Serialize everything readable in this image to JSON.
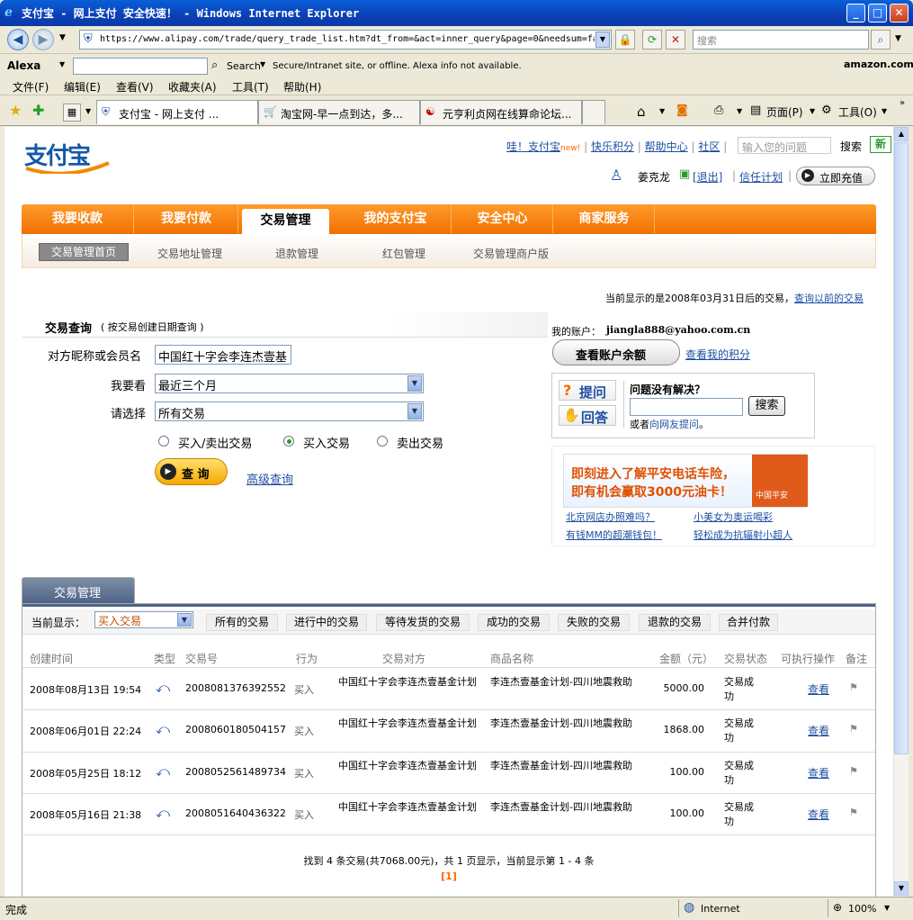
{
  "window": {
    "title": "支付宝 - 网上支付 安全快速！ - Windows Internet Explorer",
    "url": "https://www.alipay.com/trade/query_trade_list.htm?dt_from=&act=inner_query&page=0&needsum=fa",
    "search_placeholder": "搜索",
    "zoom": "100%",
    "status_left": "完成",
    "status_zone": "Internet"
  },
  "alexa": {
    "logo": "Alexa",
    "search_label": "Search",
    "info": "Secure/Intranet site, or offline. Alexa info not available.",
    "amazon": "amazon.com."
  },
  "menu": [
    "文件(F)",
    "编辑(E)",
    "查看(V)",
    "收藏夹(A)",
    "工具(T)",
    "帮助(H)"
  ],
  "tabs": [
    {
      "label": "支付宝 - 网上支付 ..."
    },
    {
      "label": "淘宝网-早一点到达，多..."
    },
    {
      "label": "元亨利贞网在线算命论坛..."
    }
  ],
  "toolbar": {
    "page": "页面(P)",
    "tools": "工具(O)"
  },
  "header": {
    "logo": "支付宝",
    "links": [
      "哇！支付宝",
      "快乐积分",
      "帮助中心",
      "社区"
    ],
    "new_tag": "new!",
    "search_placeholder": "输入您的问题",
    "search_btn": "搜索",
    "new_badge": "新",
    "user": "姜克龙",
    "logout": "[退出]",
    "trust": "信任计划",
    "recharge": "立即充值"
  },
  "nav": [
    "我要收款",
    "我要付款",
    "交易管理",
    "我的支付宝",
    "安全中心",
    "商家服务"
  ],
  "subnav": [
    "交易管理首页",
    "交易地址管理",
    "退款管理",
    "红包管理",
    "交易管理商户版"
  ],
  "notice": {
    "text": "当前显示的是2008年03月31日后的交易，",
    "link": "查询以前的交易"
  },
  "query": {
    "title": "交易查询",
    "subtitle": "( 按交易创建日期查询 )",
    "label_member": "对方昵称或会员名",
    "value_member": "中国红十字会李连杰壹基",
    "label_want": "我要看",
    "value_want": "最近三个月",
    "label_choose": "请选择",
    "value_choose": "所有交易",
    "radios": [
      "买入/卖出交易",
      "买入交易",
      "卖出交易"
    ],
    "radio_selected": 1,
    "btn": "查 询",
    "advanced": "高级查询"
  },
  "account": {
    "label": "我的账户：",
    "email": "jiangla888@yahoo.com.cn",
    "balance_btn": "查看账户余额",
    "points": "查看我的积分",
    "ask": "提问",
    "answer": "回答",
    "question": "问题没有解决？",
    "search_btn": "搜索",
    "or": "或者",
    "ask_friends": "向网友提问",
    "period": "。"
  },
  "ad": {
    "line1": "即刻进入了解平安电话车险，",
    "line2": "即有机会赢取3000元油卡！",
    "brand": "中国平安",
    "links": [
      "北京网店办照难吗？",
      "小美女为奥运喝彩",
      "有钱MM的超潮钱包！",
      "轻松成为抗辐射小超人"
    ]
  },
  "trade": {
    "tab": "交易管理",
    "current_label": "当前显示：",
    "current_value": "买入交易",
    "filters": [
      "所有的交易",
      "进行中的交易",
      "等待发货的交易",
      "成功的交易",
      "失败的交易",
      "退款的交易",
      "合并付款"
    ],
    "columns": [
      "创建时间",
      "类型",
      "交易号",
      "行为",
      "交易对方",
      "商品名称",
      "金额（元）",
      "交易状态",
      "可执行操作",
      "备注"
    ],
    "rows": [
      {
        "time": "2008年08月13日 19:54",
        "no": "2008081376392552",
        "act": "买入",
        "party": "中国红十字会李连杰壹基金计划",
        "item": "李连杰壹基金计划-四川地震救助",
        "amount": "5000.00",
        "status": "交易成功",
        "op": "查看"
      },
      {
        "time": "2008年06月01日 22:24",
        "no": "2008060180504157",
        "act": "买入",
        "party": "中国红十字会李连杰壹基金计划",
        "item": "李连杰壹基金计划-四川地震救助",
        "amount": "1868.00",
        "status": "交易成功",
        "op": "查看"
      },
      {
        "time": "2008年05月25日 18:12",
        "no": "2008052561489734",
        "act": "买入",
        "party": "中国红十字会李连杰壹基金计划",
        "item": "李连杰壹基金计划-四川地震救助",
        "amount": "100.00",
        "status": "交易成功",
        "op": "查看"
      },
      {
        "time": "2008年05月16日 21:38",
        "no": "2008051640436322",
        "act": "买入",
        "party": "中国红十字会李连杰壹基金计划",
        "item": "李连杰壹基金计划-四川地震救助",
        "amount": "100.00",
        "status": "交易成功",
        "op": "查看"
      }
    ],
    "summary": "找到 4 条交易(共7068.00元)，共 1 页显示，当前显示第 1 - 4 条",
    "page": "[1]"
  }
}
